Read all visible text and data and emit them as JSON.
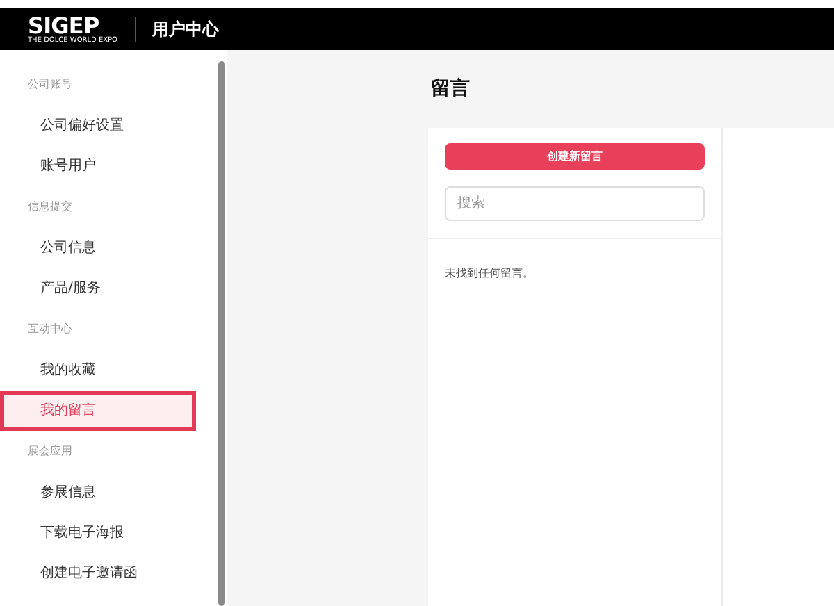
{
  "header": {
    "logo": "SIGEP",
    "tagline": "THE DOLCE WORLD EXPO",
    "title": "用户中心"
  },
  "sidebar": {
    "groups": [
      {
        "label": "公司账号",
        "items": [
          {
            "label": "公司偏好设置",
            "selected": false
          },
          {
            "label": "账号用户",
            "selected": false
          }
        ]
      },
      {
        "label": "信息提交",
        "items": [
          {
            "label": "公司信息",
            "selected": false
          },
          {
            "label": "产品/服务",
            "selected": false
          }
        ]
      },
      {
        "label": "互动中心",
        "items": [
          {
            "label": "我的收藏",
            "selected": false
          },
          {
            "label": "我的留言",
            "selected": true
          }
        ]
      },
      {
        "label": "展会应用",
        "items": [
          {
            "label": "参展信息",
            "selected": false
          },
          {
            "label": "下载电子海报",
            "selected": false
          },
          {
            "label": "创建电子邀请函",
            "selected": false
          }
        ]
      }
    ]
  },
  "page": {
    "title": "留言",
    "create_button": "创建新留言",
    "search": {
      "placeholder": "搜索"
    },
    "empty_message": "未找到任何留言。"
  }
}
